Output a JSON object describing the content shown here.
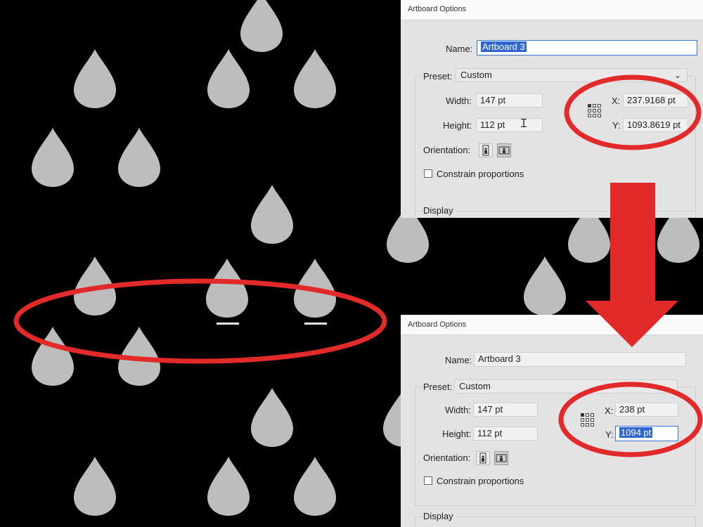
{
  "theme": {
    "drop_color": "#bdbdbd",
    "annotation_color": "#e32a2a",
    "background": "#000000",
    "selection_color": "#2f66d0"
  },
  "dialog_before": {
    "title": "Artboard Options",
    "name_label": "Name:",
    "name_value": "Artboard 3",
    "preset_label": "Preset:",
    "preset_value": "Custom",
    "width_label": "Width:",
    "width_value": "147 pt",
    "height_label": "Height:",
    "height_value": "112 pt",
    "x_label": "X:",
    "x_value": "237.9168 pt",
    "y_label": "Y:",
    "y_value": "1093.8619 pt",
    "orientation_label": "Orientation:",
    "constrain_label": "Constrain proportions",
    "display_label": "Display"
  },
  "dialog_after": {
    "title": "Artboard Options",
    "name_label": "Name:",
    "name_value": "Artboard 3",
    "preset_label": "Preset:",
    "preset_value": "Custom",
    "width_label": "Width:",
    "width_value": "147 pt",
    "height_label": "Height:",
    "height_value": "112 pt",
    "x_label": "X:",
    "x_value": "238 pt",
    "y_label": "Y:",
    "y_value": "1094 pt",
    "orientation_label": "Orientation:",
    "constrain_label": "Constrain proportions",
    "display_label": "Display"
  },
  "icons": {
    "preset_dropdown": "chevron-down-icon",
    "reference_point": "reference-point-grid-icon",
    "portrait": "portrait-orientation-icon",
    "landscape": "landscape-orientation-icon",
    "arrow": "down-arrow-icon"
  }
}
